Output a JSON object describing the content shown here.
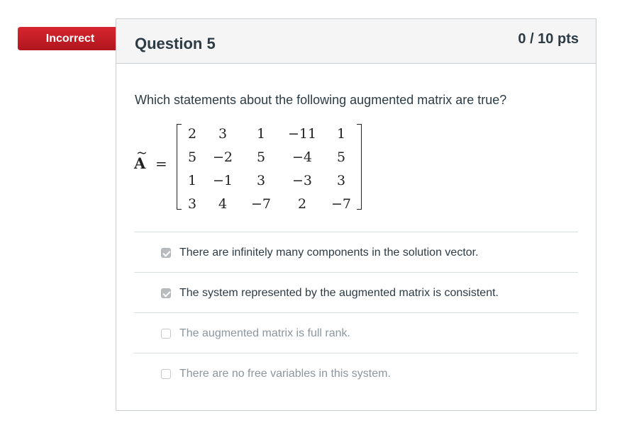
{
  "result_badge": {
    "label": "Incorrect",
    "color": "#c8202a"
  },
  "question": {
    "title": "Question 5",
    "points": "0 / 10 pts",
    "text": "Which statements about the following augmented matrix are true?"
  },
  "matrix": {
    "label": "A",
    "accent": "~",
    "equals": "=",
    "rows": [
      [
        "2",
        "3",
        "1",
        "−11",
        "1"
      ],
      [
        "5",
        "−2",
        "5",
        "−4",
        "5"
      ],
      [
        "1",
        "−1",
        "3",
        "−3",
        "3"
      ],
      [
        "3",
        "4",
        "−7",
        "2",
        "−7"
      ]
    ]
  },
  "answers": [
    {
      "text": "There are infinitely many components in the solution vector.",
      "checked": true
    },
    {
      "text": "The system represented by the augmented matrix is consistent.",
      "checked": true
    },
    {
      "text": "The augmented matrix is full rank.",
      "checked": false
    },
    {
      "text": "There are no free variables in this system.",
      "checked": false
    }
  ]
}
